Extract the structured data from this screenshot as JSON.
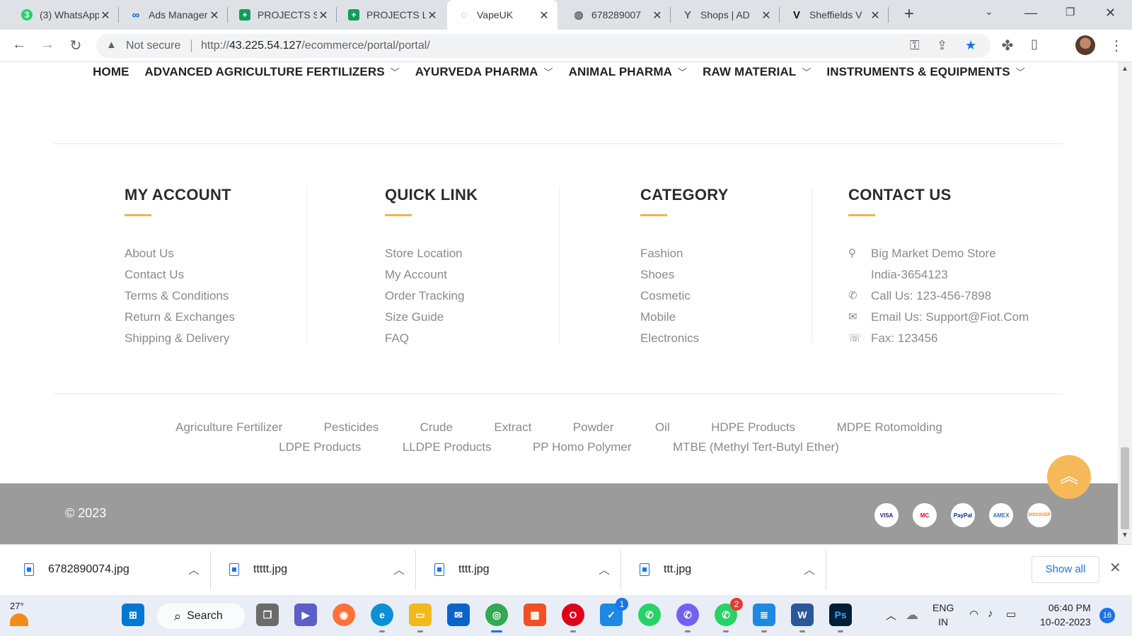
{
  "browser": {
    "tabs": [
      {
        "title": "(3) WhatsApp",
        "icon": "whatsapp-icon",
        "color": "#25d366",
        "badge": "3"
      },
      {
        "title": "Ads Manager",
        "icon": "meta-icon",
        "color": "#0668e1"
      },
      {
        "title": "PROJECTS S",
        "icon": "sheets-icon",
        "color": "#0f9d58"
      },
      {
        "title": "PROJECTS L",
        "icon": "sheets-icon",
        "color": "#0f9d58"
      },
      {
        "title": "VapeUK",
        "icon": "loading-icon",
        "color": "#2aa7d8"
      },
      {
        "title": "678289007",
        "icon": "globe-icon",
        "color": "#5f6368"
      },
      {
        "title": "Shops | AD",
        "icon": "shops-icon",
        "color": "#5f6368"
      },
      {
        "title": "Sheffields V",
        "icon": "v-icon",
        "color": "#111111"
      }
    ],
    "active_tab_index": 4,
    "address": {
      "security_label": "Not secure",
      "url_prefix": "http://",
      "url_host": "43.225.54.127",
      "url_path": "/ecommerce/portal/portal/"
    }
  },
  "nav": {
    "items": [
      {
        "label": "HOME",
        "has_dropdown": false
      },
      {
        "label": "ADVANCED AGRICULTURE FERTILIZERS",
        "has_dropdown": true
      },
      {
        "label": "AYURVEDA PHARMA",
        "has_dropdown": true
      },
      {
        "label": "ANIMAL PHARMA",
        "has_dropdown": true
      },
      {
        "label": "RAW MATERIAL",
        "has_dropdown": true
      },
      {
        "label": "INSTRUMENTS & EQUIPMENTS",
        "has_dropdown": true
      }
    ]
  },
  "footer_columns": {
    "my_account": {
      "title": "MY ACCOUNT",
      "links": [
        "About Us",
        "Contact Us",
        "Terms & Conditions",
        "Return & Exchanges",
        "Shipping & Delivery"
      ]
    },
    "quick_link": {
      "title": "QUICK LINK",
      "links": [
        "Store Location",
        "My Account",
        "Order Tracking",
        "Size Guide",
        "FAQ"
      ]
    },
    "category": {
      "title": "CATEGORY",
      "links": [
        "Fashion",
        "Shoes",
        "Cosmetic",
        "Mobile",
        "Electronics"
      ]
    },
    "contact": {
      "title": "CONTACT US",
      "address_line1": "Big Market Demo Store",
      "address_line2": "India-3654123",
      "phone": "Call Us: 123-456-7898",
      "email": "Email Us: Support@Fiot.Com",
      "fax": "Fax: 123456"
    }
  },
  "tags": [
    "Agriculture Fertilizer",
    "Pesticides",
    "Crude",
    "Extract",
    "Powder",
    "Oil",
    "HDPE Products",
    "MDPE Rotomolding",
    "LDPE Products",
    "LLDPE Products",
    "PP Homo Polymer",
    "MTBE (Methyl Tert-Butyl Ether)"
  ],
  "copyright": "© 2023",
  "payments": [
    {
      "label": "VISA",
      "color": "#1a1f71"
    },
    {
      "label": "MC",
      "color": "#eb001b"
    },
    {
      "label": "PayPal",
      "color": "#003087"
    },
    {
      "label": "AMEX",
      "color": "#2e77bb"
    },
    {
      "label": "DISCOVER",
      "color": "#f68121"
    }
  ],
  "downloads": {
    "files": [
      "6782890074.jpg",
      "ttttt.jpg",
      "tttt.jpg",
      "ttt.jpg"
    ],
    "show_all_label": "Show all"
  },
  "taskbar": {
    "weather": "27°",
    "search_label": "Search",
    "lang_line1": "ENG",
    "lang_line2": "IN",
    "time": "06:40 PM",
    "date": "10-02-2023",
    "notifications": "16",
    "apps": [
      {
        "icon": "windows-start-icon",
        "color": "#0078d4"
      },
      {
        "icon": "task-view-icon",
        "color": "#6b6b6b"
      },
      {
        "icon": "teams-chat-icon",
        "color": "#5b5fc7"
      },
      {
        "icon": "firefox-icon",
        "color": "#ff7139"
      },
      {
        "icon": "edge-icon",
        "color": "#0c8fd6"
      },
      {
        "icon": "file-explorer-icon",
        "color": "#f3b81b"
      },
      {
        "icon": "mail-icon",
        "color": "#0a64c8"
      },
      {
        "icon": "chrome-icon",
        "color": "#34a853"
      },
      {
        "icon": "store-icon",
        "color": "#f25022"
      },
      {
        "icon": "opera-icon",
        "color": "#e0001a"
      },
      {
        "icon": "vscode-icon",
        "color": "#1e88e5",
        "badge": "1"
      },
      {
        "icon": "whatsapp-icon",
        "color": "#25d366"
      },
      {
        "icon": "viber-icon",
        "color": "#7360f2"
      },
      {
        "icon": "whatsapp-business-icon",
        "color": "#25d366",
        "badge": "2"
      },
      {
        "icon": "notepad-icon",
        "color": "#1e88e5"
      },
      {
        "icon": "word-icon",
        "color": "#2b579a"
      },
      {
        "icon": "photoshop-icon",
        "color": "#001e36"
      }
    ]
  }
}
